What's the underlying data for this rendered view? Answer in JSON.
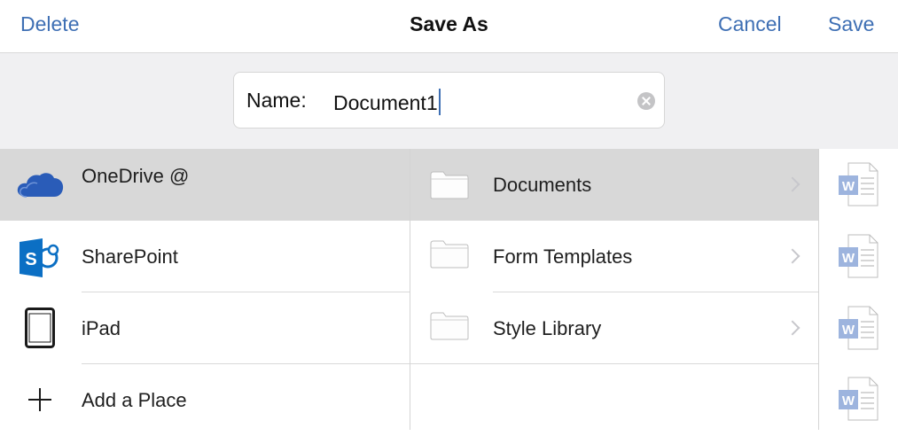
{
  "header": {
    "delete_label": "Delete",
    "title": "Save As",
    "cancel_label": "Cancel",
    "save_label": "Save"
  },
  "name_field": {
    "label": "Name:",
    "value": "Document1"
  },
  "places": [
    {
      "label": "OneDrive @",
      "icon": "onedrive-cloud-icon",
      "selected": true
    },
    {
      "label": "SharePoint",
      "icon": "sharepoint-icon",
      "selected": false
    },
    {
      "label": "iPad",
      "icon": "ipad-icon",
      "selected": false
    },
    {
      "label": "Add a Place",
      "icon": "plus-icon",
      "selected": false
    }
  ],
  "folders": [
    {
      "label": "Documents",
      "selected": true
    },
    {
      "label": "Form Templates",
      "selected": false
    },
    {
      "label": "Style Library",
      "selected": false
    }
  ],
  "recent_documents": [
    {
      "icon": "word-document-icon"
    },
    {
      "icon": "word-document-icon"
    },
    {
      "icon": "word-document-icon"
    },
    {
      "icon": "word-document-icon"
    }
  ],
  "colors": {
    "accent": "#3e6fb4",
    "selected_row": "#d8d8d8",
    "onedrive_blue": "#2a5cb8",
    "sharepoint_blue": "#0b6fc4"
  }
}
